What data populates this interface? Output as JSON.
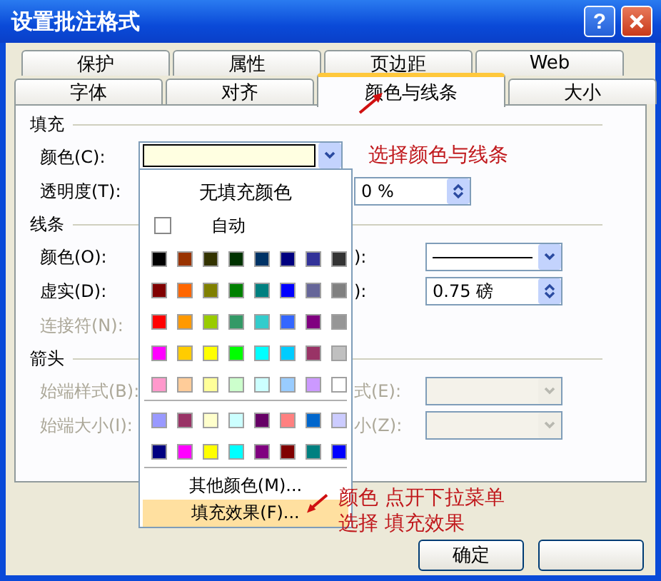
{
  "window": {
    "title": "设置批注格式",
    "help": "?"
  },
  "tab_rows": [
    [
      {
        "label": "保护",
        "selected": false
      },
      {
        "label": "属性",
        "selected": false
      },
      {
        "label": "页边距",
        "selected": false
      },
      {
        "label": "Web",
        "selected": false
      }
    ],
    [
      {
        "label": "字体",
        "selected": false
      },
      {
        "label": "对齐",
        "selected": false
      },
      {
        "label": "颜色与线条",
        "selected": true
      },
      {
        "label": "大小",
        "selected": false
      }
    ]
  ],
  "fill": {
    "heading": "填充",
    "color_label": "颜色(C):",
    "transparency_label": "透明度(T):",
    "transparency_value": "0 %"
  },
  "line": {
    "heading": "线条",
    "color_label": "颜色(O):",
    "style_label": "):",
    "dash_label": "虚实(D):",
    "weight_label": "):",
    "weight_value": "0.75 磅",
    "connector_label": "连接符(N):",
    "connector_disabled": true
  },
  "arrows": {
    "heading": "箭头",
    "disabled": true,
    "begin_style_label": "始端样式(B):",
    "end_style_label": "式(E):",
    "begin_size_label": "始端大小(I):",
    "end_size_label": "小(Z):"
  },
  "dropdown": {
    "no_fill": "无填充颜色",
    "auto": {
      "label": "自动",
      "checked": false
    },
    "standard_colors": [
      {
        "color": "#000000"
      },
      {
        "color": "#993300"
      },
      {
        "color": "#333300"
      },
      {
        "color": "#003300"
      },
      {
        "color": "#003366"
      },
      {
        "color": "#000080"
      },
      {
        "color": "#333399"
      },
      {
        "color": "#333333"
      },
      {
        "color": "#800000"
      },
      {
        "color": "#ff6600"
      },
      {
        "color": "#808000"
      },
      {
        "color": "#008000"
      },
      {
        "color": "#008080"
      },
      {
        "color": "#0000ff"
      },
      {
        "color": "#666699"
      },
      {
        "color": "#808080"
      },
      {
        "color": "#ff0000"
      },
      {
        "color": "#ff9900"
      },
      {
        "color": "#99cc00"
      },
      {
        "color": "#339966"
      },
      {
        "color": "#33cccc"
      },
      {
        "color": "#3366ff"
      },
      {
        "color": "#800080"
      },
      {
        "color": "#969696"
      },
      {
        "color": "#ff00ff"
      },
      {
        "color": "#ffcc00"
      },
      {
        "color": "#ffff00"
      },
      {
        "color": "#00ff00"
      },
      {
        "color": "#00ffff"
      },
      {
        "color": "#00ccff"
      },
      {
        "color": "#993366"
      },
      {
        "color": "#c0c0c0"
      },
      {
        "color": "#ff99cc"
      },
      {
        "color": "#ffcc99"
      },
      {
        "color": "#ffff99"
      },
      {
        "color": "#ccffcc"
      },
      {
        "color": "#ccffff"
      },
      {
        "color": "#99ccff"
      },
      {
        "color": "#cc99ff"
      },
      {
        "color": "#ffffff"
      }
    ],
    "chart_colors": [
      {
        "color": "#9999ff"
      },
      {
        "color": "#993366"
      },
      {
        "color": "#ffffcc"
      },
      {
        "color": "#ccffff"
      },
      {
        "color": "#660066"
      },
      {
        "color": "#ff8080"
      },
      {
        "color": "#0066cc"
      },
      {
        "color": "#ccccff"
      },
      {
        "color": "#000080"
      },
      {
        "color": "#ff00ff"
      },
      {
        "color": "#ffff00"
      },
      {
        "color": "#00ffff"
      },
      {
        "color": "#800080"
      },
      {
        "color": "#800000"
      },
      {
        "color": "#008080"
      },
      {
        "color": "#0000ff"
      }
    ],
    "menu_items": [
      {
        "label": "其他颜色(M)...",
        "selected": false
      },
      {
        "label": "填充效果(F)...",
        "selected": true
      }
    ]
  },
  "annotations": [
    "选择颜色与线条",
    "颜色 点开下拉菜单",
    "选择 填充效果"
  ],
  "buttons": [
    {
      "label": "确定"
    }
  ]
}
